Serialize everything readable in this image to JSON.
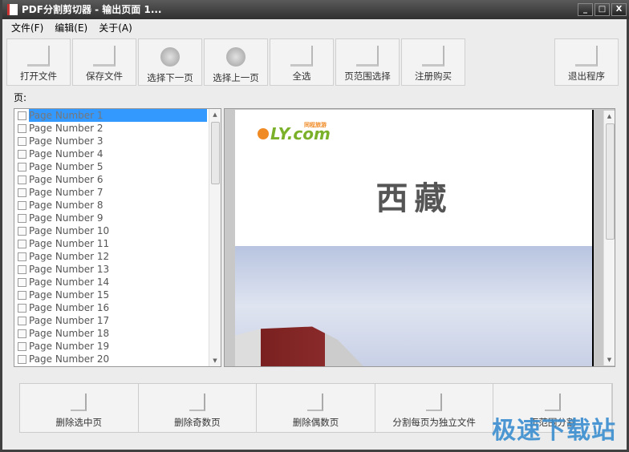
{
  "window": {
    "title": "PDF分割剪切器 - 输出页面 1...",
    "minimize": "_",
    "maximize": "□",
    "close": "X"
  },
  "menu": [
    "文件(F)",
    "编辑(E)",
    "关于(A)"
  ],
  "toolbar": [
    "打开文件",
    "保存文件",
    "选择下一页",
    "选择上一页",
    "全选",
    "页范围选择",
    "注册购买"
  ],
  "exit_label": "退出程序",
  "page_label": "页:",
  "pages": [
    "Page Number 1",
    "Page Number 2",
    "Page Number 3",
    "Page Number 4",
    "Page Number 5",
    "Page Number 6",
    "Page Number 7",
    "Page Number 8",
    "Page Number 9",
    "Page Number 10",
    "Page Number 11",
    "Page Number 12",
    "Page Number 13",
    "Page Number 14",
    "Page Number 15",
    "Page Number 16",
    "Page Number 17",
    "Page Number 18",
    "Page Number 19",
    "Page Number 20"
  ],
  "preview": {
    "logo": "LY.com",
    "logo_sub": "同程旅游",
    "title": "西藏"
  },
  "bottom_buttons": [
    "删除选中页",
    "删除奇数页",
    "删除偶数页",
    "分割每页为独立文件",
    "页范围分割"
  ],
  "watermark": "极速下载站"
}
